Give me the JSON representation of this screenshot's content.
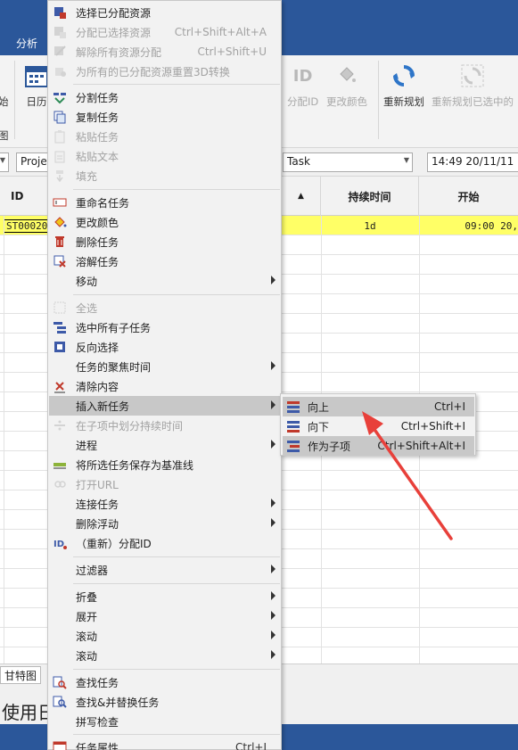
{
  "app": {
    "ribbon_tab": "分析",
    "ribbon_buttons": {
      "calendar": "日历",
      "left_partial": "始",
      "left_partial2": "图",
      "assign_id": "分配ID",
      "change_color": "更改颜色",
      "reschedule": "重新规划",
      "reschedule_selected": "重新规划已选中的"
    },
    "toolbar": {
      "project_combo": "Proje",
      "task_combo": "Task",
      "datetime_field": "14:49 20/11/11"
    },
    "grid": {
      "columns": [
        "ID",
        "持续时间",
        "开始"
      ],
      "selected_row": {
        "id": "ST00020",
        "duration": "1d",
        "start": "09:00 20,"
      }
    },
    "status": {
      "tab_label": "甘特图",
      "status_text": "使用日"
    }
  },
  "context_menu": {
    "items": [
      {
        "label": "选择已分配资源",
        "shortcut": "",
        "disabled": false,
        "icon": "select-resources-icon"
      },
      {
        "label": "分配已选择资源",
        "shortcut": "Ctrl+Shift+Alt+A",
        "disabled": true,
        "icon": "assign-resources-icon"
      },
      {
        "label": "解除所有资源分配",
        "shortcut": "Ctrl+Shift+U",
        "disabled": true,
        "icon": "unassign-resources-icon"
      },
      {
        "label": "为所有的已分配资源重置3D转换",
        "shortcut": "",
        "disabled": true,
        "icon": "reset-3d-icon"
      },
      {
        "label": "分割任务",
        "shortcut": "",
        "disabled": false,
        "icon": "split-task-icon"
      },
      {
        "label": "复制任务",
        "shortcut": "",
        "disabled": false,
        "icon": "copy-task-icon"
      },
      {
        "label": "粘贴任务",
        "shortcut": "",
        "disabled": true,
        "icon": "paste-task-icon"
      },
      {
        "label": "粘贴文本",
        "shortcut": "",
        "disabled": true,
        "icon": "paste-text-icon"
      },
      {
        "label": "填充",
        "shortcut": "",
        "disabled": true,
        "icon": "fill-down-icon"
      },
      {
        "label": "重命名任务",
        "shortcut": "",
        "disabled": false,
        "icon": "rename-icon"
      },
      {
        "label": "更改颜色",
        "shortcut": "",
        "disabled": false,
        "icon": "paint-bucket-icon"
      },
      {
        "label": "删除任务",
        "shortcut": "",
        "disabled": false,
        "icon": "trash-icon"
      },
      {
        "label": "溶解任务",
        "shortcut": "",
        "disabled": false,
        "icon": "dissolve-icon"
      },
      {
        "label": "移动",
        "shortcut": "",
        "disabled": false,
        "icon": ""
      },
      {
        "label": "全选",
        "shortcut": "",
        "disabled": true,
        "icon": "select-all-icon"
      },
      {
        "label": "选中所有子任务",
        "shortcut": "",
        "disabled": false,
        "icon": "select-children-icon"
      },
      {
        "label": "反向选择",
        "shortcut": "",
        "disabled": false,
        "icon": "invert-selection-icon"
      },
      {
        "label": "任务的聚焦时间",
        "shortcut": "",
        "disabled": false,
        "icon": ""
      },
      {
        "label": "清除内容",
        "shortcut": "",
        "disabled": false,
        "icon": "clear-content-icon"
      },
      {
        "label": "插入新任务",
        "shortcut": "",
        "disabled": false,
        "icon": ""
      },
      {
        "label": "在子项中划分持续时间",
        "shortcut": "",
        "disabled": true,
        "icon": "divide-duration-icon"
      },
      {
        "label": "进程",
        "shortcut": "",
        "disabled": false,
        "icon": ""
      },
      {
        "label": "将所选任务保存为基准线",
        "shortcut": "",
        "disabled": false,
        "icon": "baseline-icon"
      },
      {
        "label": "打开URL",
        "shortcut": "",
        "disabled": true,
        "icon": "link-icon"
      },
      {
        "label": "连接任务",
        "shortcut": "",
        "disabled": false,
        "icon": ""
      },
      {
        "label": "删除浮动",
        "shortcut": "",
        "disabled": false,
        "icon": ""
      },
      {
        "label": "（重新）分配ID",
        "shortcut": "",
        "disabled": false,
        "icon": "id-icon"
      },
      {
        "label": "过滤器",
        "shortcut": "",
        "disabled": false,
        "icon": ""
      },
      {
        "label": "折叠",
        "shortcut": "",
        "disabled": false,
        "icon": ""
      },
      {
        "label": "展开",
        "shortcut": "",
        "disabled": false,
        "icon": ""
      },
      {
        "label": "滚动",
        "shortcut": "",
        "disabled": false,
        "icon": ""
      },
      {
        "label": "滚动",
        "shortcut": "",
        "disabled": false,
        "icon": ""
      },
      {
        "label": "查找任务",
        "shortcut": "",
        "disabled": false,
        "icon": "find-icon"
      },
      {
        "label": "查找&并替换任务",
        "shortcut": "",
        "disabled": false,
        "icon": "find-replace-icon"
      },
      {
        "label": "拼写检查",
        "shortcut": "",
        "disabled": false,
        "icon": ""
      },
      {
        "label": "任务属性",
        "shortcut": "Ctrl+I",
        "disabled": false,
        "icon": "properties-icon"
      }
    ]
  },
  "submenu": {
    "items": [
      {
        "label": "向上",
        "shortcut": "Ctrl+I"
      },
      {
        "label": "向下",
        "shortcut": "Ctrl+Shift+I"
      },
      {
        "label": "作为子项",
        "shortcut": "Ctrl+Shift+Alt+I"
      }
    ]
  },
  "colors": {
    "titlebar": "#2b579a",
    "selected_row": "#ffff66",
    "annotation_arrow": "#e8403a",
    "menu_hover": "#c8c8c8"
  }
}
